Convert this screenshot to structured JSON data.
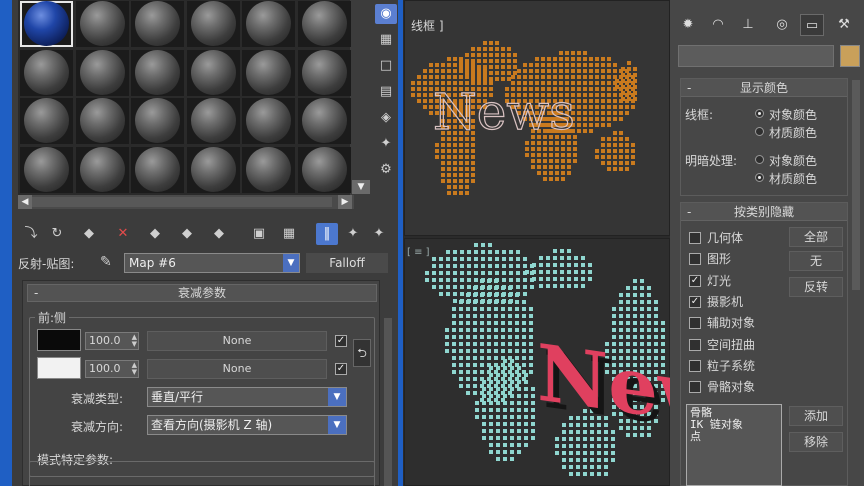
{
  "material_editor": {
    "slots": {
      "rows": 4,
      "cols": 6,
      "active_index": 0
    },
    "reflect_map_label": "反射-贴图:",
    "map_name": "Map #6",
    "map_type": "Falloff",
    "falloff": {
      "rollout_title": "衰减参数",
      "front_side_label": "前:侧",
      "row1": {
        "swatch": "#0a0a0a",
        "value": "100.0",
        "map": "None",
        "checked": true
      },
      "row2": {
        "swatch": "#f2f2f2",
        "value": "100.0",
        "map": "None",
        "checked": true
      },
      "falloff_type_label": "衰减类型:",
      "falloff_type_value": "垂直/平行",
      "falloff_dir_label": "衰减方向:",
      "falloff_dir_value": "查看方向(摄影机 Z 轴)",
      "mode_specific_label": "模式特定参数:"
    }
  },
  "viewports": {
    "top": {
      "label": "线框 ]",
      "text_3d": "News"
    },
    "bottom": {
      "text_3d": "New"
    }
  },
  "command_panel": {
    "display_color": {
      "title": "显示颜色",
      "wireframe_label": "线框:",
      "shaded_label": "明暗处理:",
      "opt_object": "对象颜色",
      "opt_material": "材质颜色"
    },
    "hide_by_category": {
      "title": "按类别隐藏",
      "items": [
        {
          "label": "几何体",
          "checked": false
        },
        {
          "label": "图形",
          "checked": false
        },
        {
          "label": "灯光",
          "checked": true
        },
        {
          "label": "摄影机",
          "checked": true
        },
        {
          "label": "辅助对象",
          "checked": false
        },
        {
          "label": "空间扭曲",
          "checked": false
        },
        {
          "label": "粒子系统",
          "checked": false
        },
        {
          "label": "骨骼对象",
          "checked": false
        }
      ],
      "btn_all": "全部",
      "btn_none": "无",
      "btn_invert": "反转",
      "list": [
        "骨骼",
        "IK 链对象",
        "点"
      ],
      "btn_add": "添加",
      "btn_remove": "移除"
    }
  },
  "icons": {
    "active_tab": "display-icon",
    "map_type_icon": "eyedropper-icon"
  }
}
